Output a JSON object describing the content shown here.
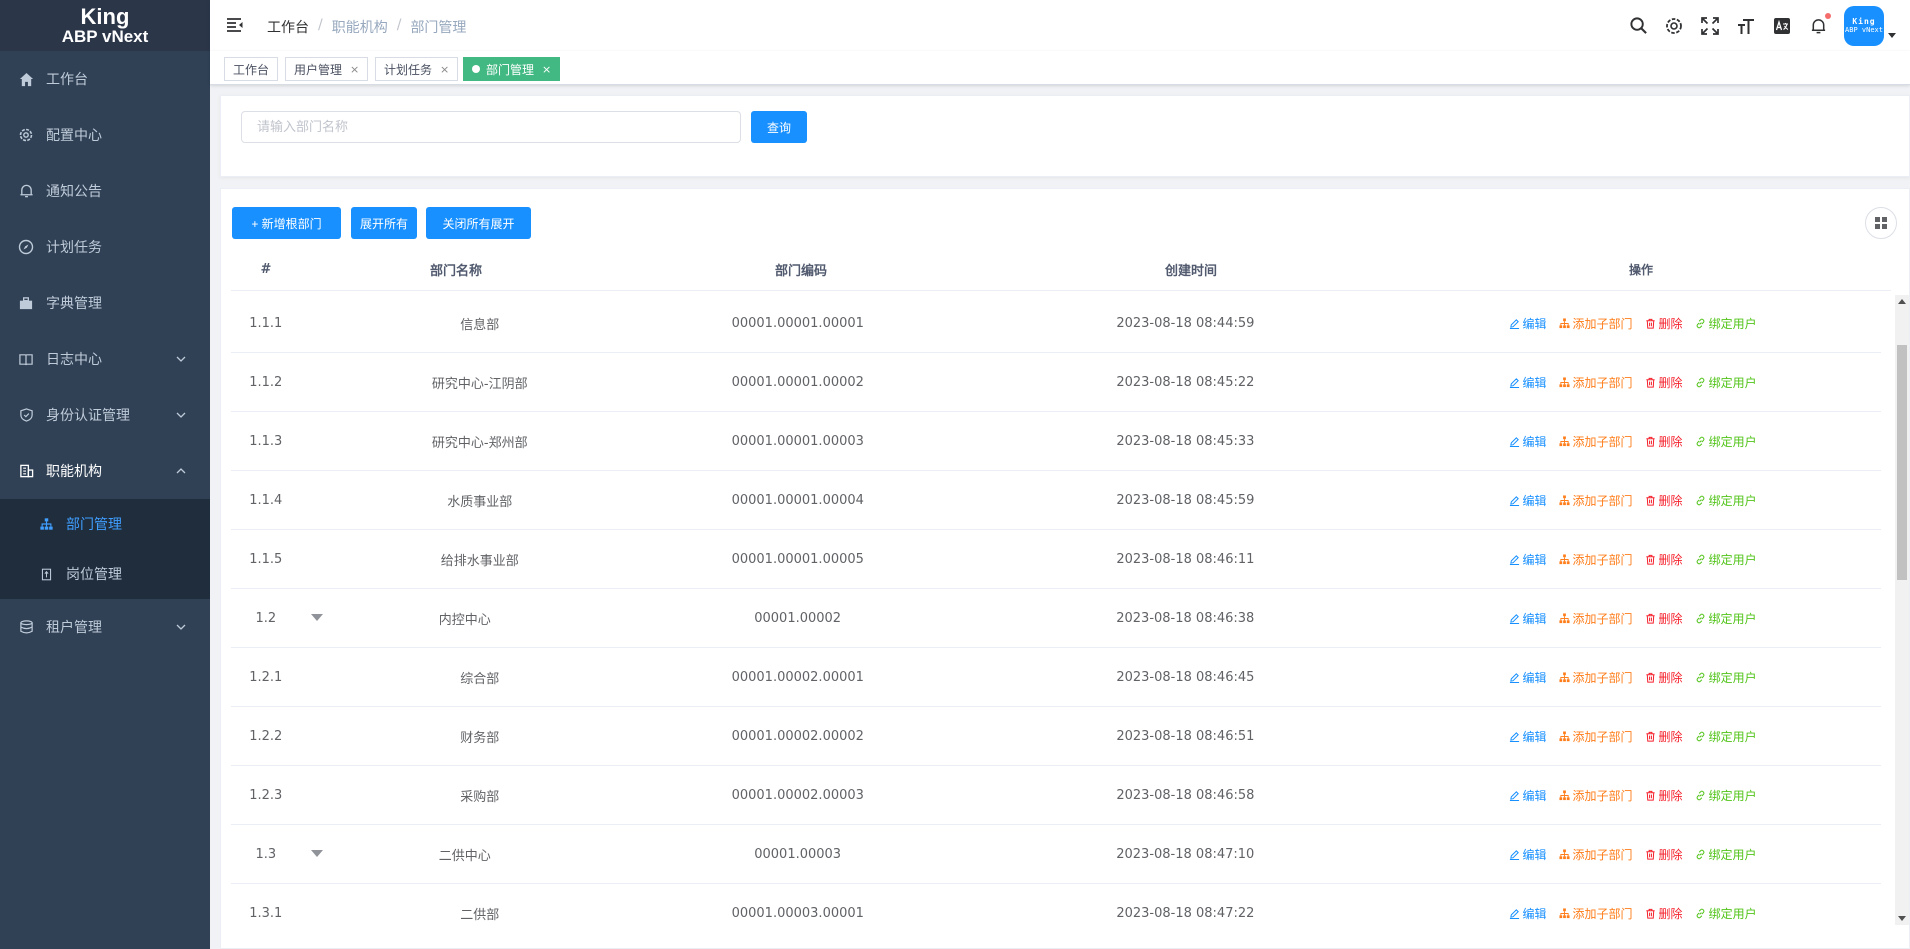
{
  "logo": {
    "line1": "King",
    "line2": "ABP vNext"
  },
  "sidebar": {
    "items": [
      {
        "label": "工作台",
        "icon": "home-icon"
      },
      {
        "label": "配置中心",
        "icon": "gear-icon"
      },
      {
        "label": "通知公告",
        "icon": "bell-icon"
      },
      {
        "label": "计划任务",
        "icon": "compass-icon"
      },
      {
        "label": "字典管理",
        "icon": "briefcase-icon"
      },
      {
        "label": "日志中心",
        "icon": "book-icon"
      },
      {
        "label": "身份认证管理",
        "icon": "shield-icon"
      },
      {
        "label": "职能机构",
        "icon": "building-icon"
      }
    ],
    "sub_items": [
      {
        "label": "部门管理",
        "icon": "org-tree-icon"
      },
      {
        "label": "岗位管理",
        "icon": "position-icon"
      }
    ],
    "last_item": {
      "label": "租户管理",
      "icon": "database-icon"
    }
  },
  "breadcrumb": {
    "level1": "工作台",
    "level2": "职能机构",
    "level3": "部门管理",
    "separator": "/"
  },
  "avatar": {
    "line1": "King",
    "line2": "ABP vNext"
  },
  "tags": {
    "t1": "工作台",
    "t2": "用户管理",
    "t3": "计划任务",
    "t4": "部门管理",
    "close": "×"
  },
  "search": {
    "placeholder": "请输入部门名称",
    "query_label": "查询"
  },
  "toolbar": {
    "add_root_label": "+ 新增根部门",
    "expand_all_label": "展开所有",
    "collapse_all_label": "关闭所有展开"
  },
  "table": {
    "headers": {
      "idx": "#",
      "name": "部门名称",
      "code": "部门编码",
      "created": "创建时间",
      "ops": "操作"
    },
    "actions": {
      "edit": "编辑",
      "add_child": "添加子部门",
      "delete": "删除",
      "bind_user": "绑定用户"
    },
    "rows": [
      {
        "idx": "1.1.1",
        "name": "信息部",
        "code": "00001.00001.00001",
        "created": "2023-08-18 08:44:59"
      },
      {
        "idx": "1.1.2",
        "name": "研究中心-江阴部",
        "code": "00001.00001.00002",
        "created": "2023-08-18 08:45:22"
      },
      {
        "idx": "1.1.3",
        "name": "研究中心-郑州部",
        "code": "00001.00001.00003",
        "created": "2023-08-18 08:45:33"
      },
      {
        "idx": "1.1.4",
        "name": "水质事业部",
        "code": "00001.00001.00004",
        "created": "2023-08-18 08:45:59"
      },
      {
        "idx": "1.1.5",
        "name": "给排水事业部",
        "code": "00001.00001.00005",
        "created": "2023-08-18 08:46:11"
      },
      {
        "idx": "1.2",
        "name": "内控中心",
        "code": "00001.00002",
        "created": "2023-08-18 08:46:38"
      },
      {
        "idx": "1.2.1",
        "name": "综合部",
        "code": "00001.00002.00001",
        "created": "2023-08-18 08:46:45"
      },
      {
        "idx": "1.2.2",
        "name": "财务部",
        "code": "00001.00002.00002",
        "created": "2023-08-18 08:46:51"
      },
      {
        "idx": "1.2.3",
        "name": "采购部",
        "code": "00001.00002.00003",
        "created": "2023-08-18 08:46:58"
      },
      {
        "idx": "1.3",
        "name": "二供中心",
        "code": "00001.00003",
        "created": "2023-08-18 08:47:10"
      },
      {
        "idx": "1.3.1",
        "name": "二供部",
        "code": "00001.00003.00001",
        "created": "2023-08-18 08:47:22"
      }
    ]
  },
  "colors": {
    "primary": "#1890ff",
    "sidebar_bg": "#304156",
    "active_tag": "#42b983",
    "edit": "#1890ff",
    "add_child": "#ff7d1a",
    "delete": "#f5222d",
    "bind": "#52c41a"
  }
}
